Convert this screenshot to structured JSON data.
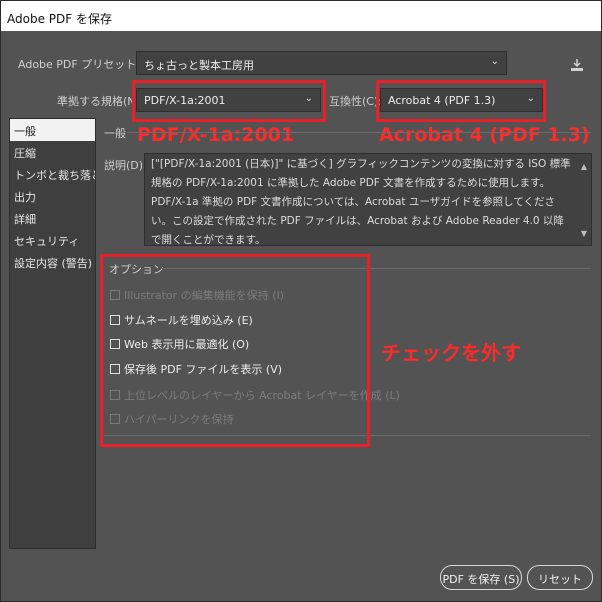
{
  "window": {
    "title": "Adobe PDF を保存"
  },
  "preset": {
    "label": "Adobe PDF プリセット(A):",
    "value": "ちょ古っと製本工房用"
  },
  "standard": {
    "label": "準拠する規格(N):",
    "value": "PDF/X-1a:2001"
  },
  "compat": {
    "label": "互換性(C):",
    "value": "Acrobat 4 (PDF 1.3)"
  },
  "sidebar": {
    "items": [
      {
        "label": "一般"
      },
      {
        "label": "圧縮"
      },
      {
        "label": "トンボと裁ち落とし"
      },
      {
        "label": "出力"
      },
      {
        "label": "詳細"
      },
      {
        "label": "セキュリティ"
      },
      {
        "label": "設定内容 (警告)"
      }
    ]
  },
  "general": {
    "header": "一般",
    "desc_label": "説明(D):",
    "description": "[\"[PDF/X-1a:2001 (日本)]\" に基づく] グラフィックコンテンツの変換に対する ISO 標準規格の PDF/X-1a:2001 に準拠した Adobe PDF 文書を作成するために使用します。PDF/X-1a 準拠の PDF 文書作成については、Acrobat ユーザガイドを参照してください。この設定で作成された PDF ファイルは、Acrobat および Adobe Reader 4.0 以降で開くことができます。"
  },
  "options": {
    "title": "オプション",
    "items": [
      {
        "label": "Illustrator の編集機能を保持 (I)",
        "checked": false,
        "enabled": false
      },
      {
        "label": "サムネールを埋め込み (E)",
        "checked": false,
        "enabled": true
      },
      {
        "label": "Web 表示用に最適化 (O)",
        "checked": false,
        "enabled": true
      },
      {
        "label": "保存後 PDF ファイルを表示 (V)",
        "checked": false,
        "enabled": true
      },
      {
        "label": "上位レベルのレイヤーから Acrobat レイヤーを作成 (L)",
        "checked": false,
        "enabled": false
      },
      {
        "label": "ハイパーリンクを保持",
        "checked": false,
        "enabled": false
      }
    ]
  },
  "annotations": {
    "standard": "PDF/X-1a:2001",
    "compat": "Acrobat 4 (PDF 1.3)",
    "uncheck": "チェックを外す",
    "color": "#e8202a"
  },
  "buttons": {
    "save": "PDF を保存 (S)",
    "reset": "リセット"
  },
  "icons": {
    "save_preset": "save-preset-icon",
    "dropdown": "chevron-down-icon"
  }
}
